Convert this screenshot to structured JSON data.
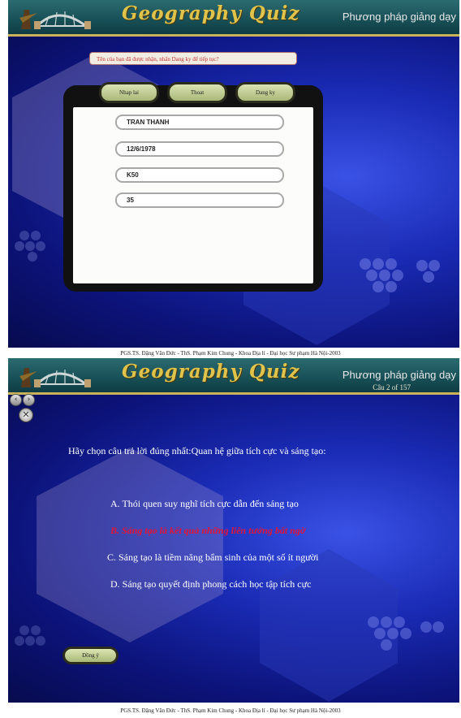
{
  "header": {
    "title": "Geography Quiz",
    "subtitle": "Phương pháp giảng dạy"
  },
  "footer": "PGS.TS. Đặng Văn Đức - ThS. Phạm Kim Chung - Khoa Địa lí - Đại học Sư phạm Hà Nội-2003",
  "login": {
    "notice": "Tên của bạn đã được nhận, nhấn Dang ky để tiếp tục?",
    "buttons": {
      "reenter": "Nhap lai",
      "exit": "Thoat",
      "register": "Dang ky"
    },
    "fields": [
      "TRAN THANH",
      "12/6/1978",
      "K50",
      "35"
    ]
  },
  "quiz": {
    "counter": "Câu 2 of 157",
    "question": "Hãy chọn câu trả lời đúng nhất:Quan hệ giữa tích cực và sáng tạo:",
    "options": [
      "A. Thói quen suy nghĩ tích cực dẫn đến sáng tạo",
      "B. Sáng tạo là kết quả những liên tưởng bất ngờ",
      "C. Sáng tạo là tiềm năng bẩm sinh của một số ít người",
      "D. Sáng tạo quyết định phong cách học tập tích cực"
    ],
    "selected_option": "B",
    "confirm": "Đồng ý",
    "nav_icons": [
      "prev-icon",
      "next-icon",
      "close-icon"
    ]
  },
  "colors": {
    "header": "#1c5a60",
    "title": "#e0c34a",
    "background": "#1a2bb5",
    "selected": "#e0153a"
  }
}
